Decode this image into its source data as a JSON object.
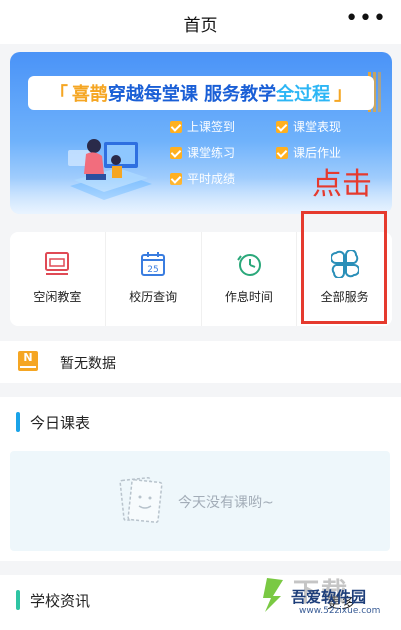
{
  "topbar": {
    "title": "首页",
    "more_glyph": "•••"
  },
  "banner": {
    "headline_bracket_left": "「",
    "headline_part1": "喜鹊",
    "headline_part2": "穿越每堂课 服务教学",
    "headline_part3": "全过程",
    "headline_bracket_right": "」",
    "features": [
      "上课签到",
      "课堂表现",
      "课堂练习",
      "课后作业",
      "平时成绩"
    ],
    "accent_color": "#1a5fd6",
    "highlight_color": "#f5a623"
  },
  "annotation": {
    "text": "点击",
    "color": "#e53a2e"
  },
  "services": [
    {
      "label": "空闲教室",
      "icon": "classroom-icon"
    },
    {
      "label": "校历查询",
      "icon": "calendar-icon",
      "icon_text": "25"
    },
    {
      "label": "作息时间",
      "icon": "clock-icon"
    },
    {
      "label": "全部服务",
      "icon": "grid-clover-icon"
    }
  ],
  "notice": {
    "badge": "N",
    "text": "暂无数据"
  },
  "today": {
    "title": "今日课表",
    "bar_color": "#1aa3e8",
    "empty_text": "今天没有课哟~"
  },
  "news": {
    "title": "学校资讯",
    "bar_color": "#2ec4a3",
    "more_label": "更多"
  },
  "watermark": {
    "big": "下载",
    "name": "吾爱软件园",
    "url": "www.52zixue.com"
  }
}
